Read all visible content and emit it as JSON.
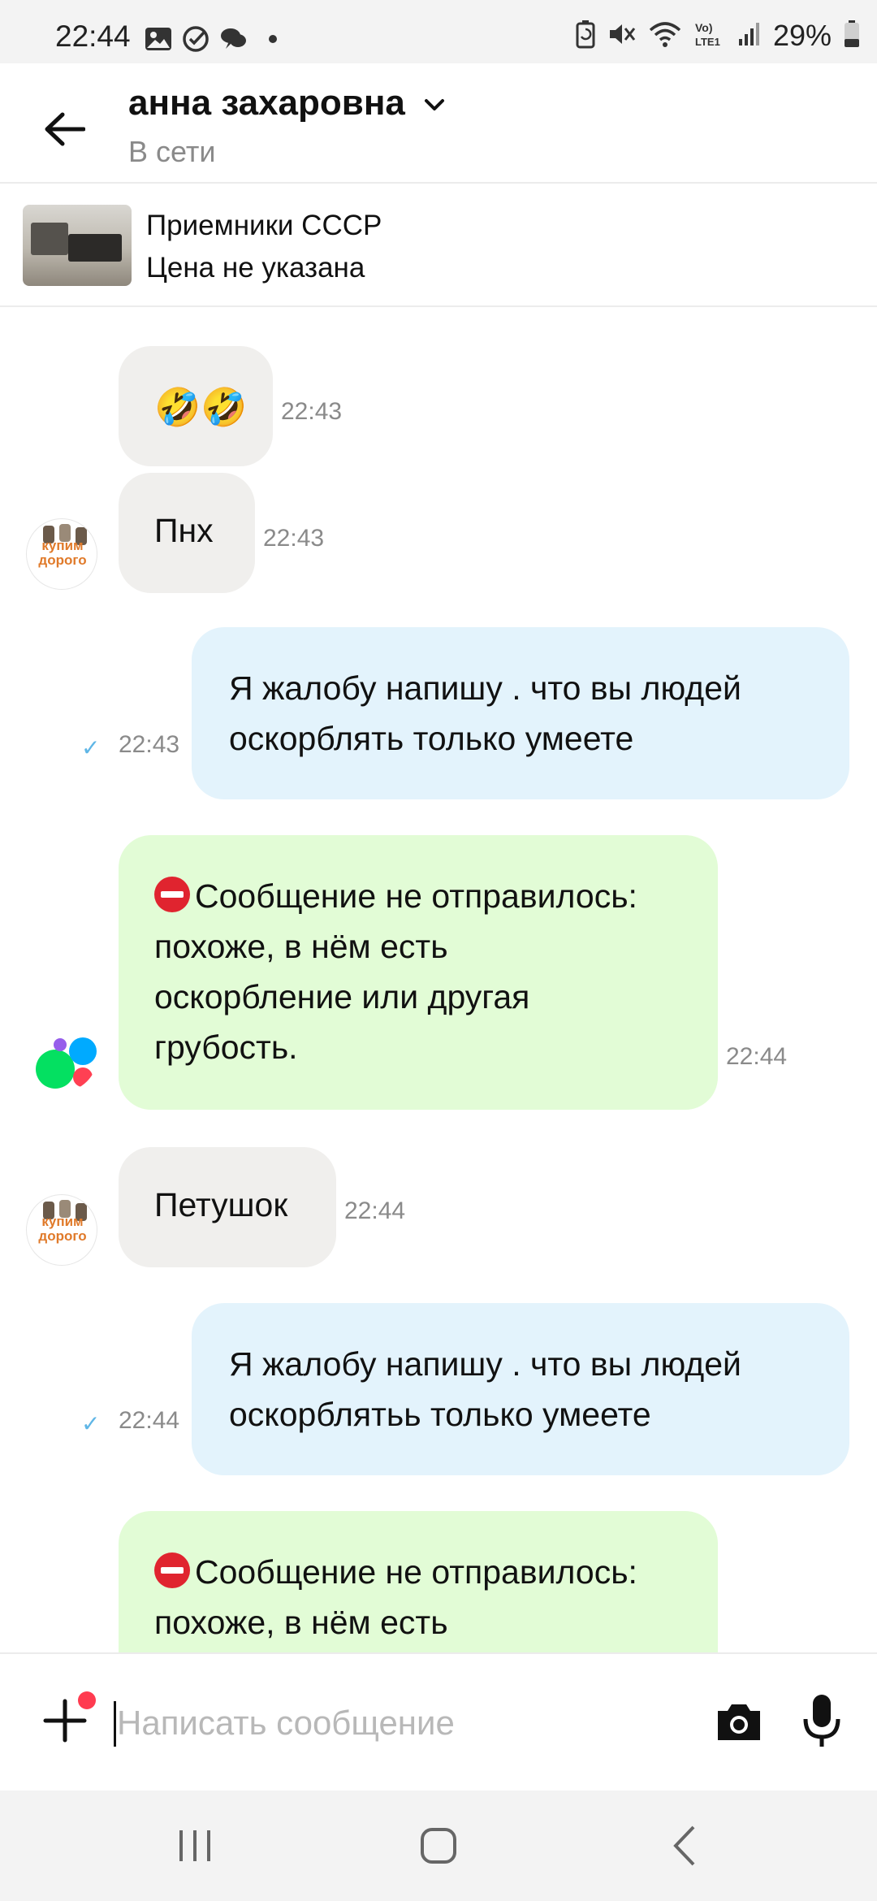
{
  "status_bar": {
    "time": "22:44",
    "battery_percent": "29%",
    "left_icons": [
      "gallery-icon",
      "check-circle-icon",
      "chat-icon",
      "dot-icon"
    ],
    "right_icons": [
      "battery-saver-icon",
      "mute-icon",
      "wifi-icon",
      "volte-icon",
      "signal-icon",
      "battery-icon"
    ],
    "volte_label": "Vo) LTE1"
  },
  "header": {
    "contact_name": "анна захаровна",
    "contact_status": "В сети"
  },
  "listing": {
    "title": "Приемники СССР",
    "price": "Цена не указана"
  },
  "avatar": {
    "line1": "купим",
    "line2": "дорого"
  },
  "messages": [
    {
      "id": "m1",
      "direction": "incoming",
      "text": "🤣🤣",
      "time": "22:43"
    },
    {
      "id": "m2",
      "direction": "incoming",
      "text": "Пнх",
      "time": "22:43"
    },
    {
      "id": "m3",
      "direction": "outgoing",
      "lines": [
        "Я жалобу напишу . что вы людей",
        "оскорблять только умеете"
      ],
      "time": "22:43",
      "read": true
    },
    {
      "id": "m4",
      "direction": "system",
      "lines": [
        "Сообщение не отправилось:",
        "похоже, в нём есть",
        "оскорбление или другая",
        "грубость."
      ],
      "time": "22:44"
    },
    {
      "id": "m5",
      "direction": "incoming",
      "text": "Петушок",
      "time": "22:44"
    },
    {
      "id": "m6",
      "direction": "outgoing",
      "lines": [
        "Я жалобу напишу . что вы людей",
        "оскорблятьь только умеете"
      ],
      "time": "22:44",
      "read": true
    },
    {
      "id": "m7",
      "direction": "system",
      "lines": [
        "Сообщение не отправилось:",
        "похоже, в нём есть"
      ]
    }
  ],
  "input": {
    "placeholder": "Написать сообщение",
    "value": ""
  },
  "nav": [
    "recent-apps",
    "home",
    "back"
  ],
  "colors": {
    "incoming_bubble": "#f0efed",
    "outgoing_bubble": "#e3f3fc",
    "system_bubble": "#e2fcd6",
    "notification_dot": "#ff3b50",
    "read_check": "#5fb6e6"
  }
}
